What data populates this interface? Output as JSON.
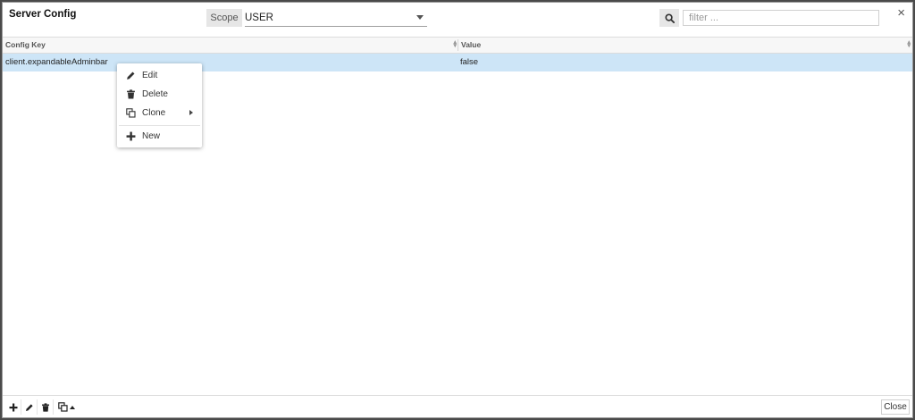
{
  "dialog": {
    "title": "Server Config",
    "close_glyph": "×"
  },
  "toolbar": {
    "scope_label": "Scope",
    "scope_value": "USER",
    "search_icon": "search-icon",
    "filter_placeholder": "filter ..."
  },
  "grid": {
    "columns": [
      "Config Key",
      "Value"
    ],
    "rows": [
      {
        "key": "client.expandableAdminbar",
        "value": "false"
      }
    ]
  },
  "context_menu": {
    "items": [
      {
        "label": "Edit",
        "icon": "pencil-icon"
      },
      {
        "label": "Delete",
        "icon": "trash-icon"
      },
      {
        "label": "Clone",
        "icon": "clone-icon",
        "has_submenu": true
      },
      {
        "label": "New",
        "icon": "plus-icon"
      }
    ]
  },
  "footer": {
    "buttons": [
      "plus-icon",
      "pencil-icon",
      "trash-icon",
      "clone-icon"
    ],
    "close_label": "Close"
  },
  "colors": {
    "selected_row": "#cde5f7",
    "header_bg": "#f7f7f7",
    "scope_bg": "#e6e6e6"
  }
}
